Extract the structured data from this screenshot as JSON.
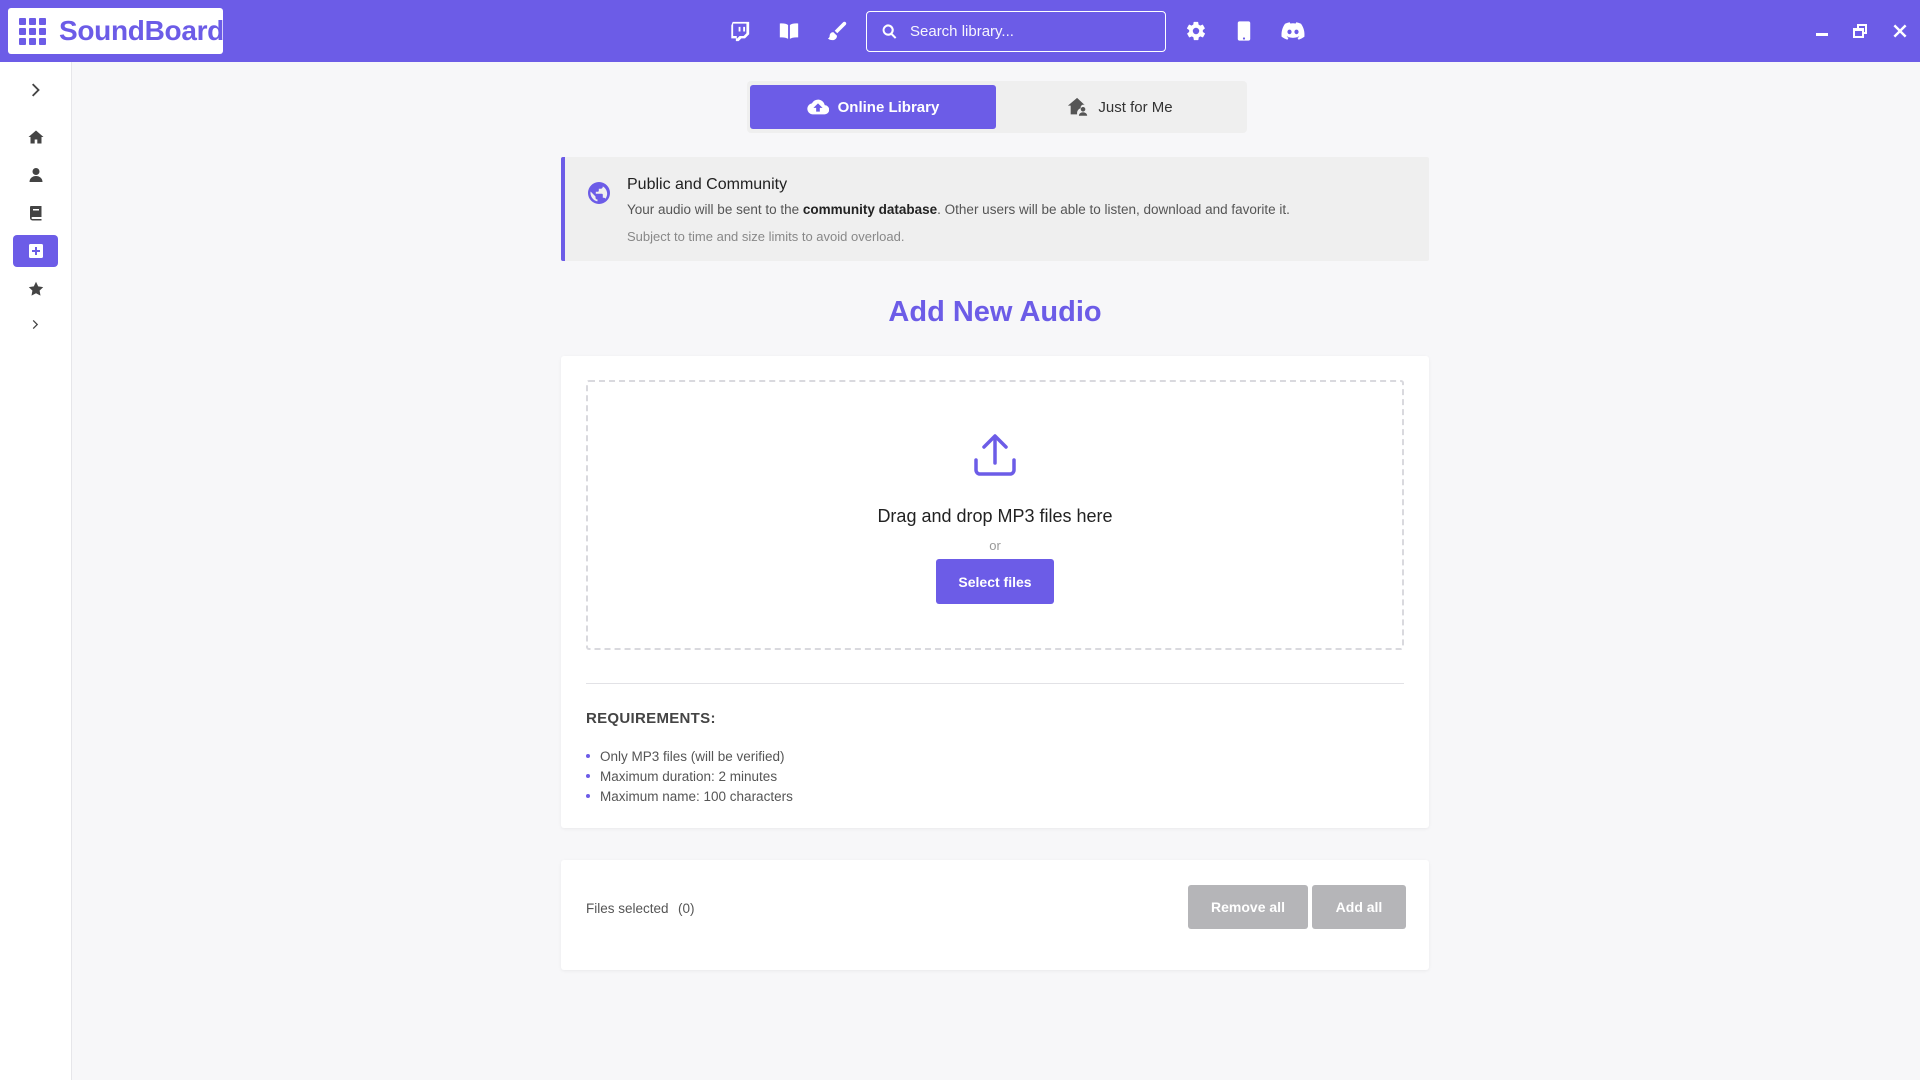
{
  "app": {
    "name": "SoundBoard",
    "accent": "#6c5ce7"
  },
  "topbar": {
    "icons": [
      "twitch-icon",
      "book-open-icon",
      "paint-brush-icon",
      "gear-icon",
      "mobile-icon",
      "discord-icon"
    ],
    "search": {
      "placeholder": "Search library...",
      "value": ""
    },
    "window_controls": [
      "minimize-icon",
      "restore-icon",
      "close-icon"
    ]
  },
  "sidebar": {
    "items": [
      {
        "icon": "chevron-right-icon"
      },
      {
        "icon": "home-icon"
      },
      {
        "icon": "user-icon"
      },
      {
        "icon": "book-icon"
      },
      {
        "icon": "plus-square-icon",
        "active": true
      },
      {
        "icon": "star-icon"
      },
      {
        "icon": "chevron-right-small-icon"
      }
    ]
  },
  "tabs": {
    "online": "Online Library",
    "personal": "Just for Me",
    "active": "online"
  },
  "info": {
    "title": "Public and Community",
    "line_before": "Your audio will be sent to the ",
    "line_bold": "community database",
    "line_after": ". Other users will be able to listen, download and favorite it.",
    "subtext": "Subject to time and size limits to avoid overload."
  },
  "page_title": "Add New Audio",
  "dropzone": {
    "title": "Drag and drop MP3 files here",
    "or": "or",
    "button": "Select files"
  },
  "requirements": {
    "title": "REQUIREMENTS:",
    "items": [
      "Only MP3 files (will be verified)",
      "Maximum duration: 2 minutes",
      "Maximum name: 100 characters"
    ]
  },
  "files": {
    "label": "Files selected",
    "count": "(0)",
    "remove_all": "Remove all",
    "add_all": "Add all"
  }
}
